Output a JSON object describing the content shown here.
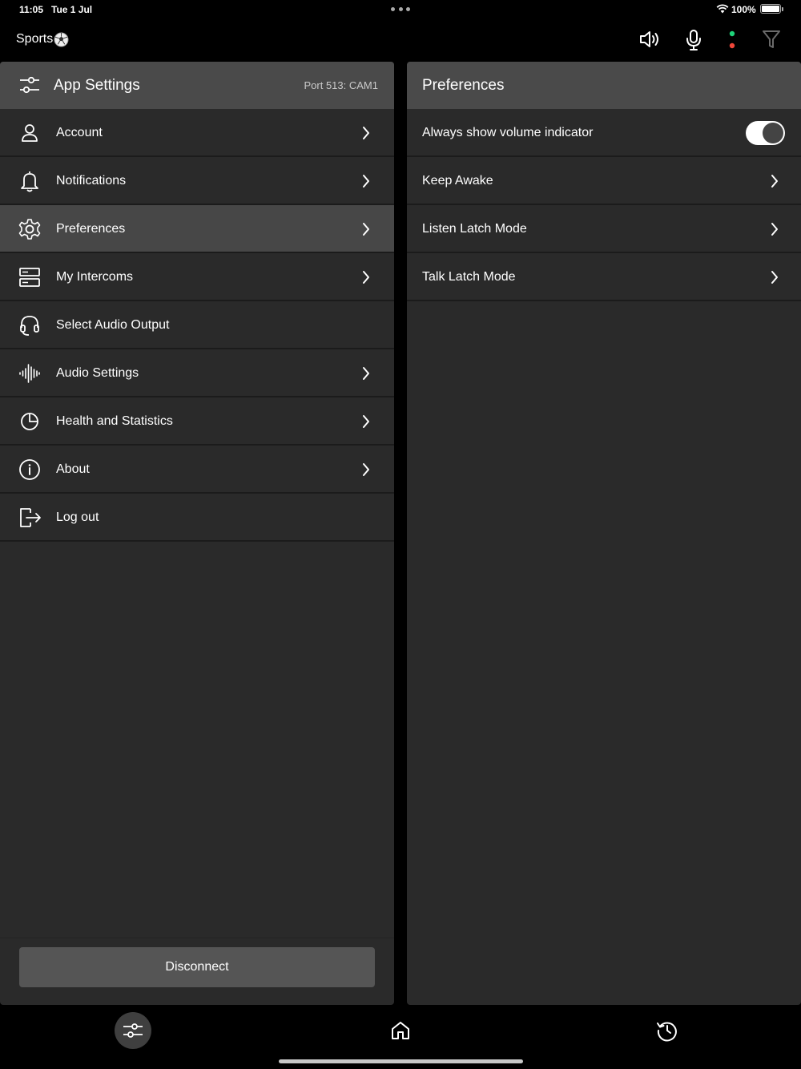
{
  "status_bar": {
    "time": "11:05",
    "date": "Tue 1 Jul",
    "battery": "100%"
  },
  "top_bar": {
    "title": "Sports",
    "icons": [
      "speaker-icon",
      "microphone-icon",
      "status-dots-icon",
      "filter-icon"
    ],
    "status_colors": {
      "online": "#1ed47a",
      "alert": "#f0473a"
    }
  },
  "left_panel": {
    "title": "App Settings",
    "port_label": "Port 513: CAM1",
    "items": [
      {
        "label": "Account",
        "icon": "person-icon",
        "chevron": true
      },
      {
        "label": "Notifications",
        "icon": "bell-icon",
        "chevron": true
      },
      {
        "label": "Preferences",
        "icon": "gear-icon",
        "chevron": true,
        "active": true
      },
      {
        "label": "My Intercoms",
        "icon": "server-icon",
        "chevron": true
      },
      {
        "label": "Select Audio Output",
        "icon": "headset-icon",
        "chevron": false
      },
      {
        "label": "Audio Settings",
        "icon": "waveform-icon",
        "chevron": true
      },
      {
        "label": "Health and Statistics",
        "icon": "pie-chart-icon",
        "chevron": true
      },
      {
        "label": "About",
        "icon": "info-icon",
        "chevron": true
      },
      {
        "label": "Log out",
        "icon": "logout-icon",
        "chevron": false
      }
    ],
    "disconnect_label": "Disconnect"
  },
  "right_panel": {
    "title": "Preferences",
    "items": [
      {
        "label": "Always show volume indicator",
        "type": "toggle",
        "value": true
      },
      {
        "label": "Keep Awake",
        "type": "chevron"
      },
      {
        "label": "Listen Latch Mode",
        "type": "chevron"
      },
      {
        "label": "Talk Latch Mode",
        "type": "chevron"
      }
    ]
  },
  "tab_bar": {
    "tabs": [
      {
        "name": "settings",
        "icon": "sliders-icon",
        "active": true
      },
      {
        "name": "home",
        "icon": "home-icon",
        "active": false
      },
      {
        "name": "history",
        "icon": "history-icon",
        "active": false
      }
    ]
  },
  "colors": {
    "background": "#000000",
    "panel": "#2a2a2a",
    "header": "#4a4a4a",
    "active_row": "#474747"
  }
}
